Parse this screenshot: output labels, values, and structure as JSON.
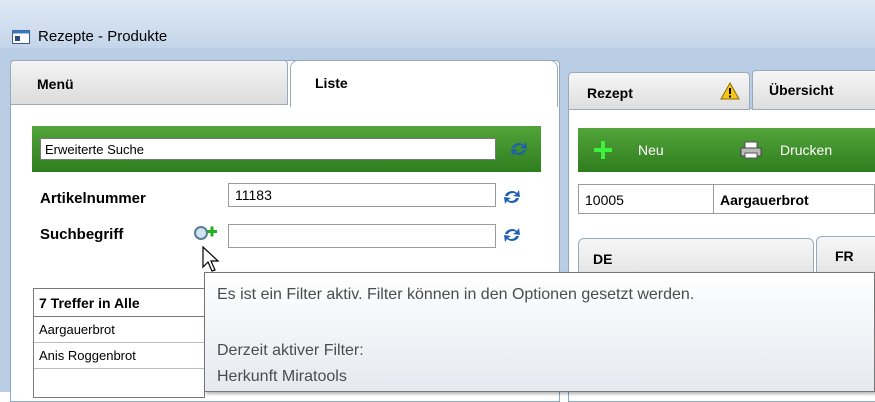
{
  "window": {
    "title": "Rezepte - Produkte",
    "icon": "window-app-icon"
  },
  "left_tabs": {
    "menu": "Menü",
    "liste": "Liste"
  },
  "search": {
    "mode_value": "Erweiterte Suche",
    "artikelnummer_label": "Artikelnummer",
    "artikelnummer_value": "11183",
    "suchbegriff_label": "Suchbegriff",
    "suchbegriff_value": ""
  },
  "results": {
    "header": "7 Treffer in Alle",
    "rows": [
      "Aargauerbrot",
      "Anis Roggenbrot"
    ]
  },
  "right_tabs": {
    "rezept": "Rezept",
    "uebersicht": "Übersicht"
  },
  "toolbar": {
    "neu": "Neu",
    "drucken": "Drucken"
  },
  "record": {
    "number": "10005",
    "name": "Aargauerbrot"
  },
  "lang_tabs": {
    "de": "DE",
    "fr": "FR"
  },
  "tooltip": {
    "line1": "Es ist ein Filter aktiv. Filter können in den Optionen gesetzt werden.",
    "line2": "Derzeit aktiver Filter:",
    "line3": "Herkunft Miratools"
  },
  "colors": {
    "toolbar_green": "#3b8f2a",
    "refresh_blue": "#1f5fb0",
    "title_gradient": "#c4d5ea"
  }
}
